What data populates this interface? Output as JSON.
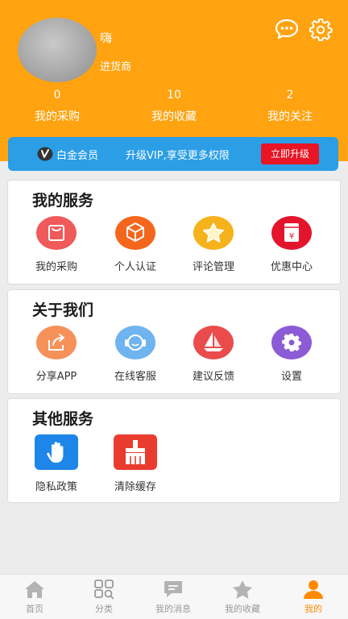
{
  "header": {
    "username": "嗨",
    "role": "进货商",
    "stats": [
      {
        "num": "0",
        "label": "我的采购"
      },
      {
        "num": "10",
        "label": "我的收藏"
      },
      {
        "num": "2",
        "label": "我的关注"
      }
    ]
  },
  "vip": {
    "name": "白金会员",
    "desc": "升级VIP,享受更多权限",
    "button": "立即升级"
  },
  "services": {
    "title": "我的服务",
    "items": [
      {
        "label": "我的采购",
        "icon": "shopping-bag-icon"
      },
      {
        "label": "个人认证",
        "icon": "cube-icon"
      },
      {
        "label": "评论管理",
        "icon": "star-icon"
      },
      {
        "label": "优惠中心",
        "icon": "coupon-icon"
      }
    ]
  },
  "about": {
    "title": "关于我们",
    "items": [
      {
        "label": "分享APP",
        "icon": "share-icon"
      },
      {
        "label": "在线客服",
        "icon": "headset-icon"
      },
      {
        "label": "建议反馈",
        "icon": "sailboat-icon"
      },
      {
        "label": "设置",
        "icon": "gear-icon"
      }
    ]
  },
  "other": {
    "title": "其他服务",
    "items": [
      {
        "label": "隐私政策",
        "icon": "hand-icon"
      },
      {
        "label": "清除缓存",
        "icon": "broom-icon"
      }
    ]
  },
  "tabs": [
    {
      "label": "首页",
      "icon": "home-icon"
    },
    {
      "label": "分类",
      "icon": "grid-search-icon"
    },
    {
      "label": "我的消息",
      "icon": "chat-icon"
    },
    {
      "label": "我的收藏",
      "icon": "star-icon"
    },
    {
      "label": "我的",
      "icon": "user-icon"
    }
  ],
  "colors": {
    "header": "#ffa310",
    "vip_bar": "#2b9ee6",
    "vip_button": "#e81524",
    "active_tab": "#ff8a00"
  }
}
